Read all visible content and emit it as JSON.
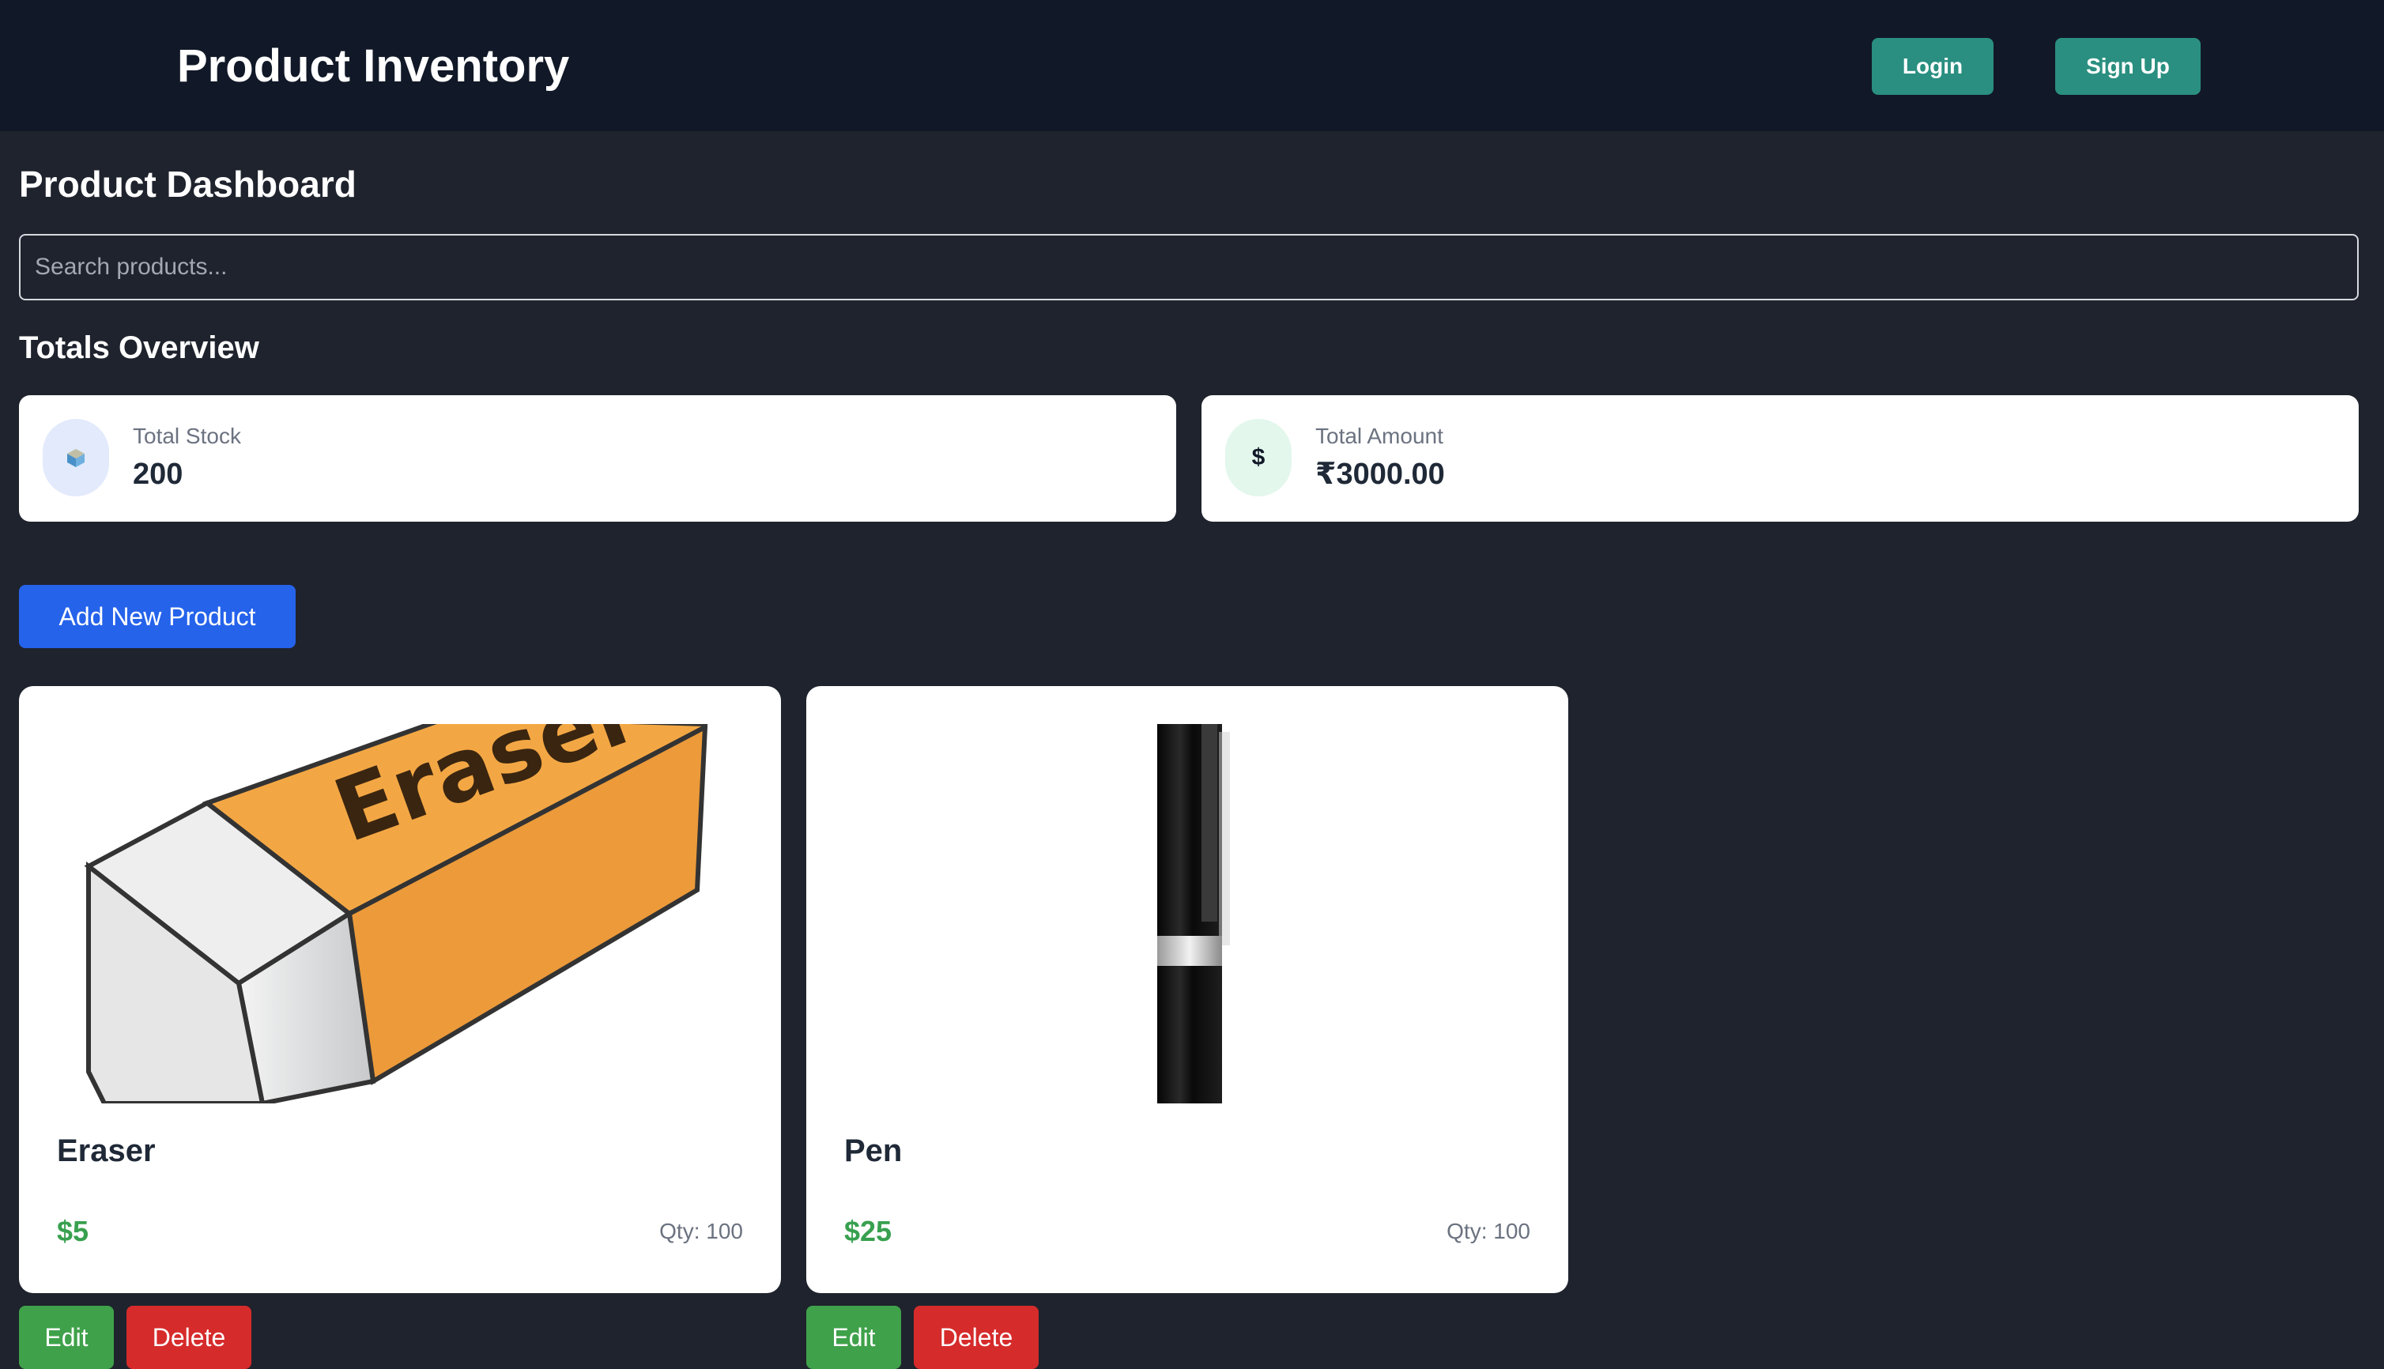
{
  "header": {
    "title": "Product Inventory",
    "login_label": "Login",
    "signup_label": "Sign Up"
  },
  "dashboard": {
    "title": "Product Dashboard",
    "search_placeholder": "Search products...",
    "totals_title": "Totals Overview"
  },
  "totals": {
    "stock": {
      "label": "Total Stock",
      "value": "200",
      "icon": "cube-icon"
    },
    "amount": {
      "label": "Total Amount",
      "value": "₹3000.00",
      "icon": "dollar-icon",
      "icon_glyph": "$"
    }
  },
  "add_product_label": "Add New Product",
  "products": [
    {
      "name": "Eraser",
      "price": "$5",
      "qty_label": "Qty:",
      "qty": "100",
      "edit_label": "Edit",
      "delete_label": "Delete",
      "image_text": "Eraser"
    },
    {
      "name": "Pen",
      "price": "$25",
      "qty_label": "Qty:",
      "qty": "100",
      "edit_label": "Edit",
      "delete_label": "Delete"
    }
  ],
  "colors": {
    "navbar": "#111827",
    "background": "#1f232d",
    "teal_button": "#2a8f80",
    "primary_button": "#2563eb",
    "edit_button": "#3fa14a",
    "delete_button": "#d62b2b",
    "price_text": "#38a04f"
  }
}
